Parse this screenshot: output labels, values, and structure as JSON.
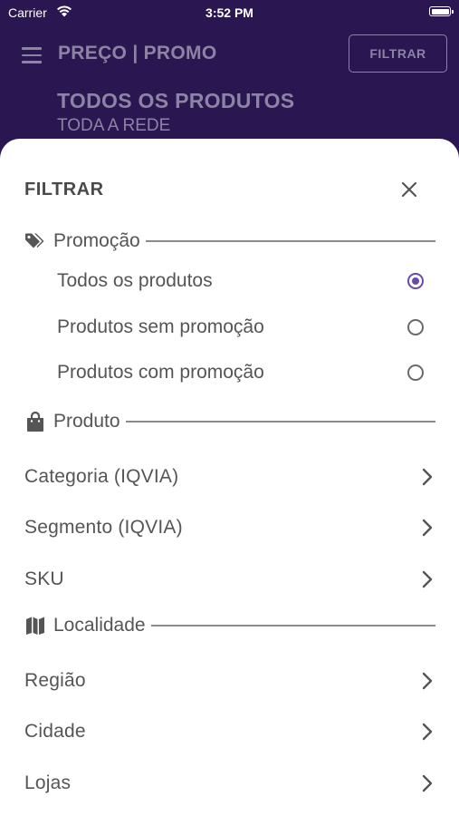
{
  "status_bar": {
    "carrier": "Carrier",
    "time": "3:52 PM"
  },
  "header": {
    "title": "PREÇO | PROMO",
    "filter_button": "FILTRAR",
    "subtitle": "TODOS OS PRODUTOS",
    "subsubtitle": "TODA A REDE"
  },
  "sheet": {
    "title": "FILTRAR",
    "promo_section": {
      "label": "Promoção",
      "icon": "tags-icon",
      "options": [
        {
          "label": "Todos os produtos",
          "selected": true
        },
        {
          "label": "Produtos sem promoção",
          "selected": false
        },
        {
          "label": "Produtos com promoção",
          "selected": false
        }
      ]
    },
    "product_section": {
      "label": "Produto",
      "icon": "shopping-bag-icon",
      "items": [
        {
          "label": "Categoria (IQVIA)"
        },
        {
          "label": "Segmento (IQVIA)"
        },
        {
          "label": "SKU"
        }
      ]
    },
    "locality_section": {
      "label": "Localidade",
      "icon": "map-icon",
      "items": [
        {
          "label": "Região"
        },
        {
          "label": "Cidade"
        },
        {
          "label": "Lojas"
        }
      ]
    }
  },
  "colors": {
    "header_bg": "#2a1650",
    "accent": "#6a4aa8",
    "text": "#555555"
  }
}
